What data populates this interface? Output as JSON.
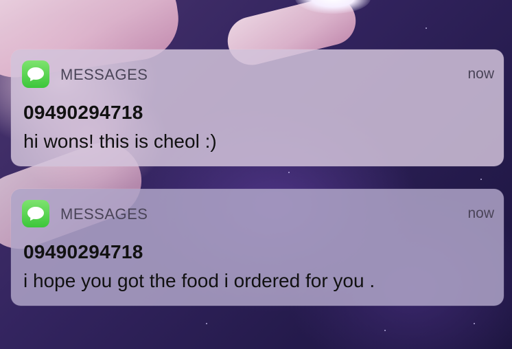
{
  "notifications": [
    {
      "app_name": "MESSAGES",
      "app_icon": "messages-icon",
      "time": "now",
      "sender": "09490294718",
      "message": "hi wons! this is cheol :)"
    },
    {
      "app_name": "MESSAGES",
      "app_icon": "messages-icon",
      "time": "now",
      "sender": "09490294718",
      "message": "i hope you got the food i ordered for you ."
    }
  ],
  "colors": {
    "app_icon_green": "#3cc63a",
    "card_tint": "#c8bed7",
    "wallpaper": "#2a1d56"
  }
}
